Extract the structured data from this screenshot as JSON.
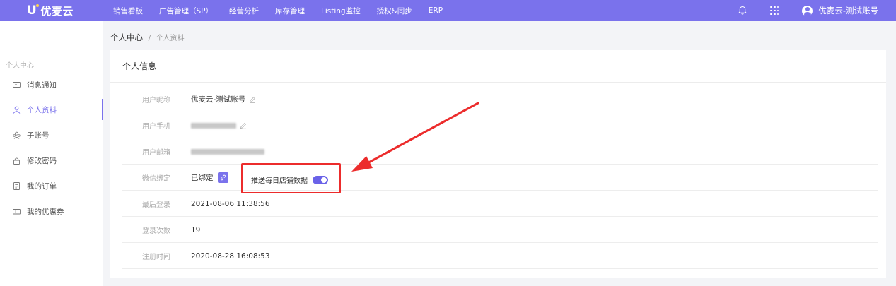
{
  "header": {
    "brand": "优麦云",
    "nav": [
      "销售看板",
      "广告管理（SP）",
      "经营分析",
      "库存管理",
      "Listing监控",
      "授权&同步",
      "ERP"
    ],
    "user_name": "优麦云-测试账号"
  },
  "sidebar": {
    "section_title": "个人中心",
    "items": [
      {
        "label": "消息通知",
        "icon": "message-icon"
      },
      {
        "label": "个人资料",
        "icon": "user-icon"
      },
      {
        "label": "子账号",
        "icon": "sub-account-icon"
      },
      {
        "label": "修改密码",
        "icon": "lock-icon"
      },
      {
        "label": "我的订单",
        "icon": "order-icon"
      },
      {
        "label": "我的优惠券",
        "icon": "coupon-icon"
      }
    ],
    "active_index": 1
  },
  "breadcrumb": {
    "root": "个人中心",
    "separator": "/",
    "current": "个人资料"
  },
  "card": {
    "title": "个人信息",
    "rows": [
      {
        "label": "用户昵称",
        "value": "优麦云-测试账号"
      },
      {
        "label": "用户手机",
        "value": ""
      },
      {
        "label": "用户邮箱",
        "value": ""
      },
      {
        "label": "微信绑定",
        "value": "已绑定"
      },
      {
        "label": "最后登录",
        "value": "2021-08-06 11:38:56"
      },
      {
        "label": "登录次数",
        "value": "19"
      },
      {
        "label": "注册时间",
        "value": "2020-08-28 16:08:53"
      }
    ],
    "push_daily_label": "推送每日店铺数据",
    "push_daily_enabled": true
  },
  "colors": {
    "primary": "#7a72ec",
    "highlight": "#ec2c2c"
  }
}
